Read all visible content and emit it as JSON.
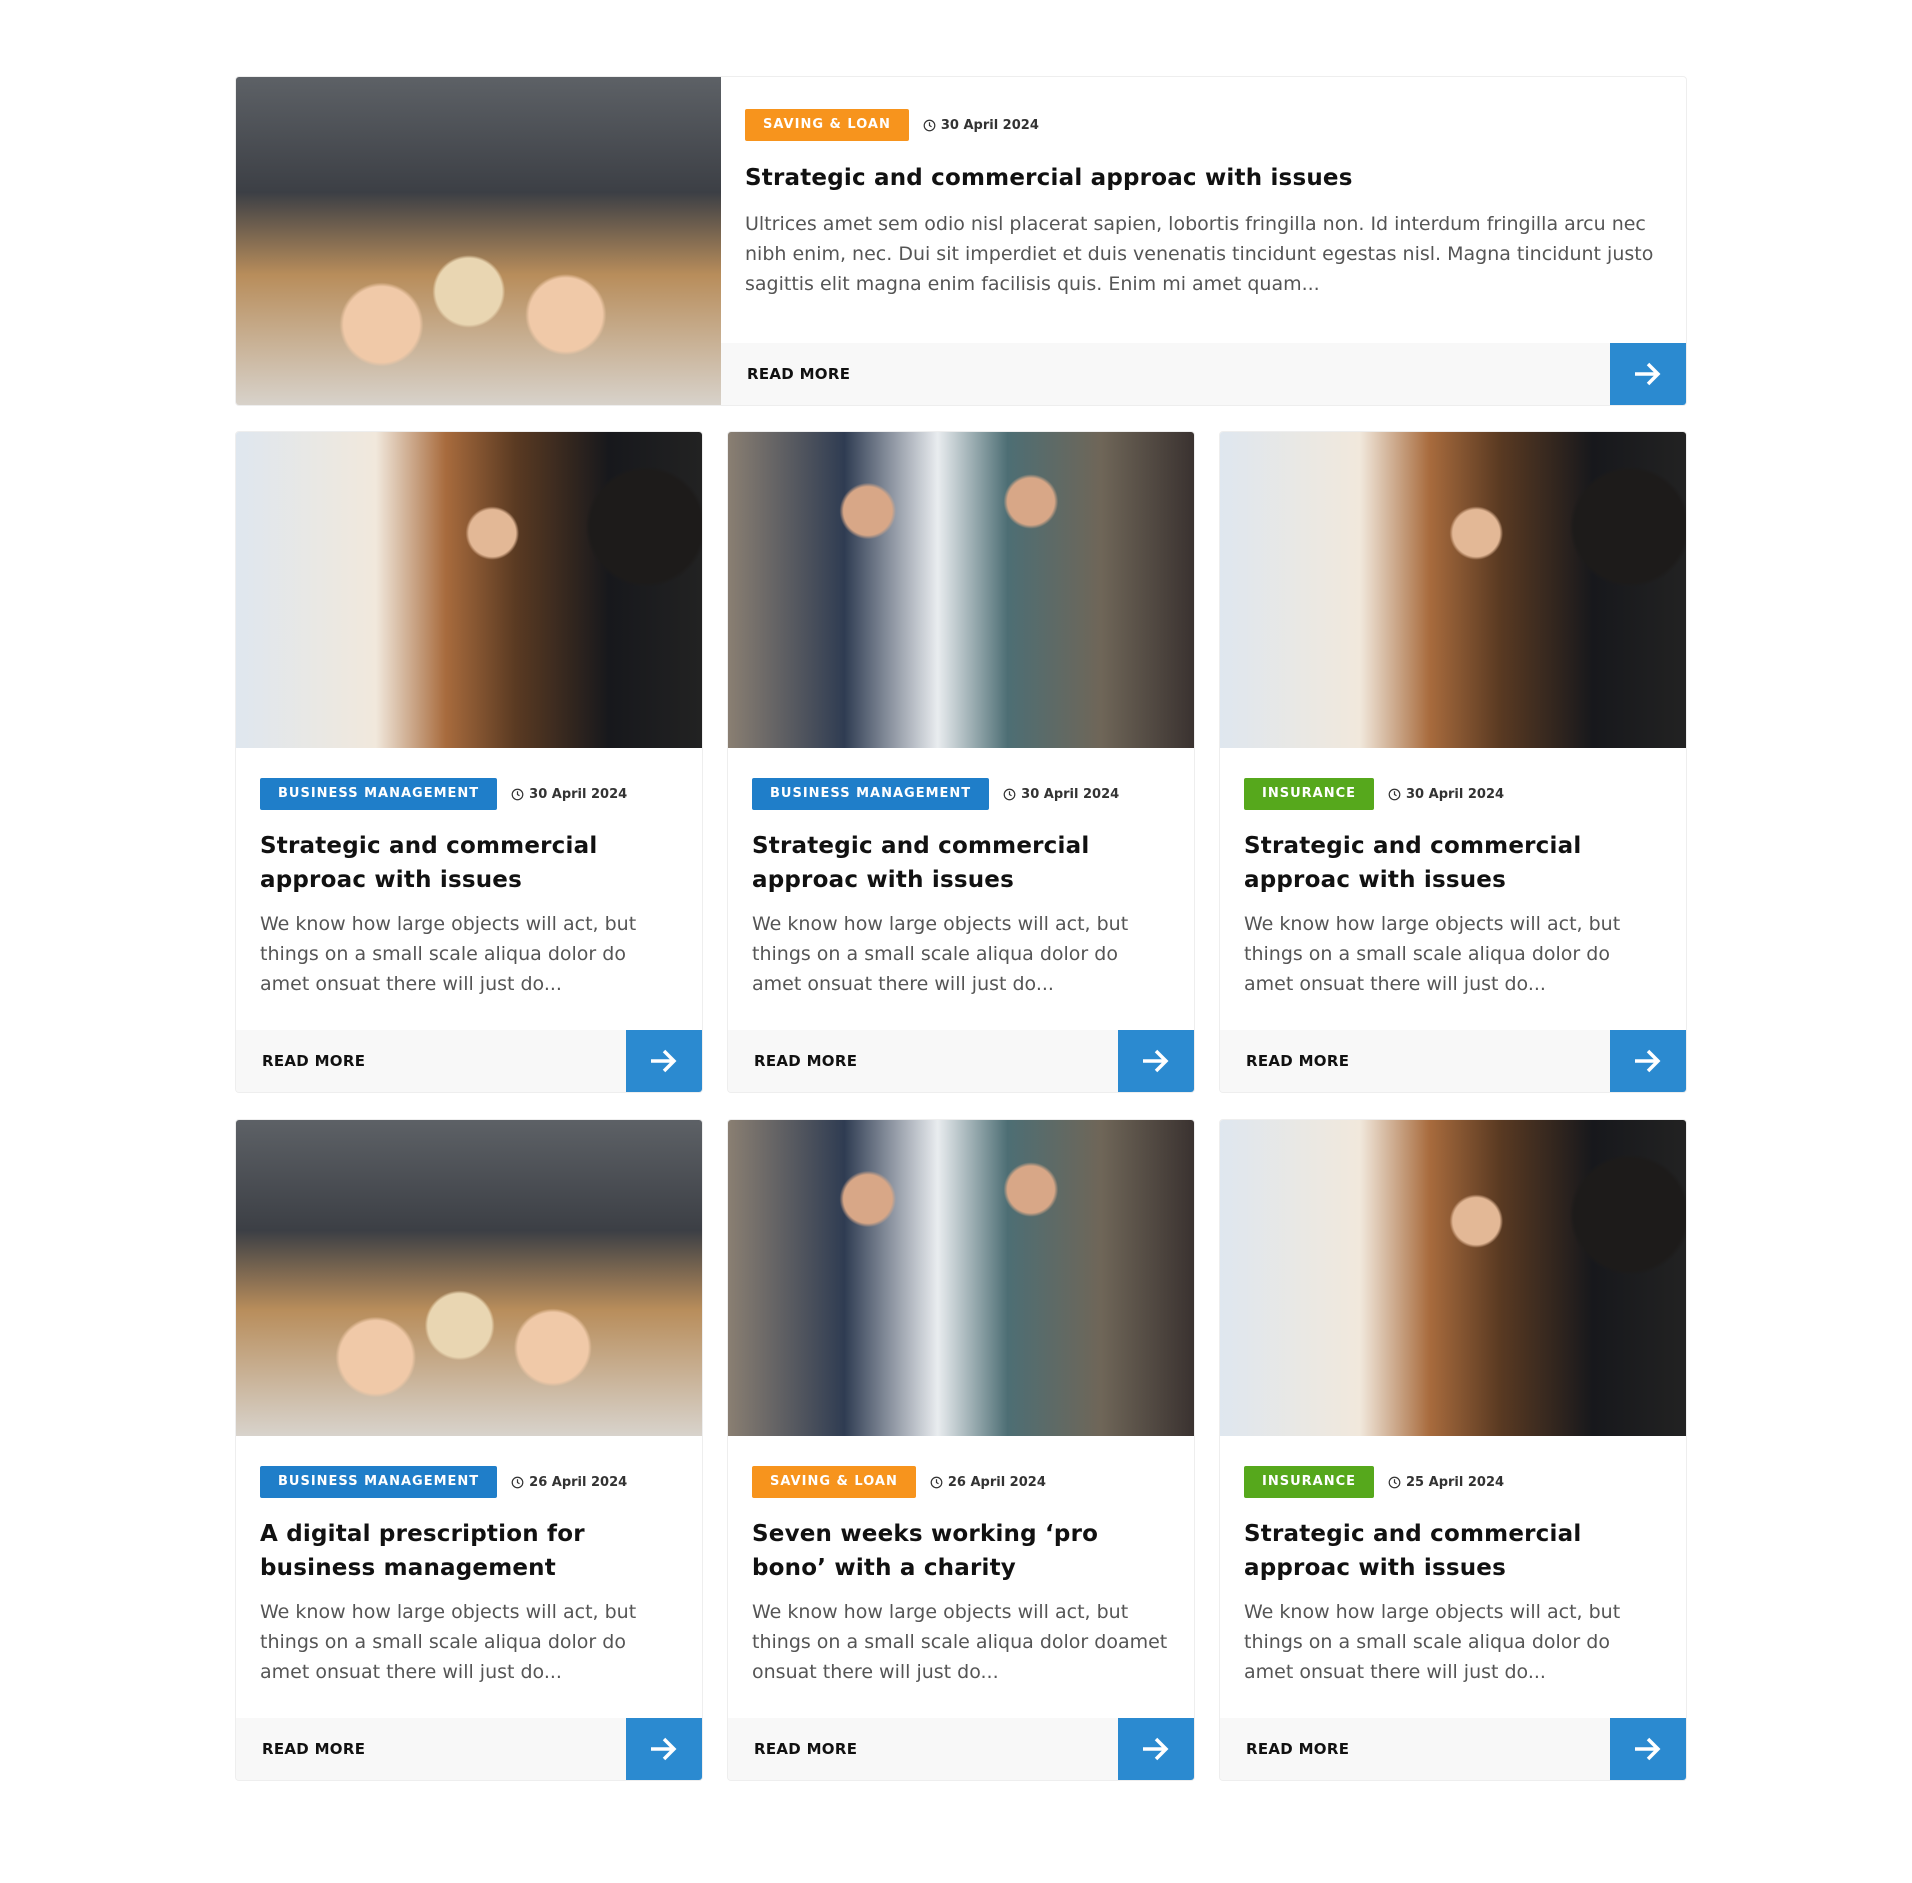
{
  "featured": {
    "category": "SAVING & LOAN",
    "category_color": "#f7941d",
    "date": "30 April 2024",
    "title": "Strategic and commercial approac with issues",
    "excerpt": "Ultrices amet sem odio nisl placerat sapien, lobortis fringilla non. Id interdum fringilla arcu nec nibh enim, nec. Dui sit imperdiet et duis venenatis tincidunt egestas nisl. Magna tincidunt justo sagittis elit magna enim facilisis quis. Enim mi amet quam...",
    "read_more": "READ MORE"
  },
  "posts": [
    {
      "category": "BUSINESS MANAGEMENT",
      "category_color": "#1f7ec9",
      "date": "30 April 2024",
      "title": "Strategic and commercial approac with issues",
      "excerpt": "We know how large objects will act, but things on a small scale aliqua dolor do amet onsuat there will just do...",
      "read_more": "READ MORE"
    },
    {
      "category": "BUSINESS MANAGEMENT",
      "category_color": "#1f7ec9",
      "date": "30 April 2024",
      "title": "Strategic and commercial approac with issues",
      "excerpt": "We know how large objects will act, but things on a small scale aliqua dolor do amet onsuat there will just do...",
      "read_more": "READ MORE"
    },
    {
      "category": "INSURANCE",
      "category_color": "#56a81c",
      "date": "30 April 2024",
      "title": "Strategic and commercial approac with issues",
      "excerpt": "We know how large objects will act, but things on a small scale aliqua dolor do amet onsuat there will just do...",
      "read_more": "READ MORE"
    },
    {
      "category": "BUSINESS MANAGEMENT",
      "category_color": "#1f7ec9",
      "date": "26 April 2024",
      "title": "A digital prescription for business management",
      "excerpt": "We know how large objects will act, but things on a small scale aliqua dolor do amet onsuat there will just do...",
      "read_more": "READ MORE"
    },
    {
      "category": "SAVING & LOAN",
      "category_color": "#f7941d",
      "date": "26 April 2024",
      "title": "Seven weeks working ‘pro bono’ with a charity",
      "excerpt": "We know how large objects will act, but things on a small scale aliqua dolor doamet onsuat there will just do...",
      "read_more": "READ MORE"
    },
    {
      "category": "INSURANCE",
      "category_color": "#56a81c",
      "date": "25 April 2024",
      "title": "Strategic and commercial approac with issues",
      "excerpt": "We know how large objects will act, but things on a small scale aliqua dolor do amet onsuat there will just do...",
      "read_more": "READ MORE"
    }
  ],
  "icons": {
    "date_icon": "clock-icon",
    "button_icon": "arrow-right-icon"
  }
}
